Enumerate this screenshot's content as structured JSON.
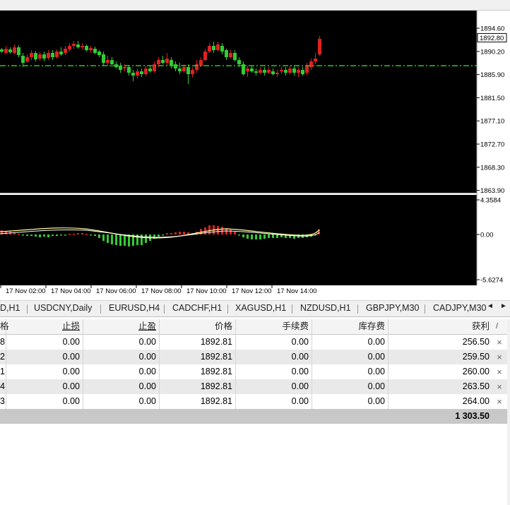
{
  "chart": {
    "price_axis": [
      "1894.60",
      "1890.20",
      "1885.90",
      "1881.50",
      "1877.10",
      "1872.70",
      "1868.30",
      "1863.90"
    ],
    "current_price": "1892.80",
    "indicator_axis": [
      "4.3584",
      "0.00",
      "-5.6274"
    ],
    "time_axis": [
      "17 Nov 02:00",
      "17 Nov 04:00",
      "17 Nov 06:00",
      "17 Nov 08:00",
      "17 Nov 10:00",
      "17 Nov 12:00",
      "17 Nov 14:00"
    ],
    "colors": {
      "bull": "#33cc33",
      "bear": "#dd2222",
      "level": "#22cc22",
      "signal": "#ffff99",
      "background": "#000000"
    }
  },
  "tabs": [
    {
      "label": "D,H1"
    },
    {
      "label": "USDCNY,Daily"
    },
    {
      "label": "EURUSD,H4"
    },
    {
      "label": "CADCHF,H1"
    },
    {
      "label": "XAGUSD,H1"
    },
    {
      "label": "NZDUSD,H1"
    },
    {
      "label": "GBPJPY,M30"
    },
    {
      "label": "CADJPY,M30"
    }
  ],
  "tab_scroll": {
    "left": "◄",
    "right": "►"
  },
  "table": {
    "headers": [
      "格",
      "止损",
      "止盈",
      "价格",
      "手续费",
      "库存费",
      "获利"
    ],
    "sort_mark": "/",
    "rows": [
      [
        "8",
        "0.00",
        "0.00",
        "1892.81",
        "0.00",
        "0.00",
        "256.50"
      ],
      [
        "2",
        "0.00",
        "0.00",
        "1892.81",
        "0.00",
        "0.00",
        "259.50"
      ],
      [
        "1",
        "0.00",
        "0.00",
        "1892.81",
        "0.00",
        "0.00",
        "260.00"
      ],
      [
        "4",
        "0.00",
        "0.00",
        "1892.81",
        "0.00",
        "0.00",
        "263.50"
      ],
      [
        "3",
        "0.00",
        "0.00",
        "1892.81",
        "0.00",
        "0.00",
        "264.00"
      ]
    ],
    "close_icon": "×",
    "total": "1 303.50"
  }
}
